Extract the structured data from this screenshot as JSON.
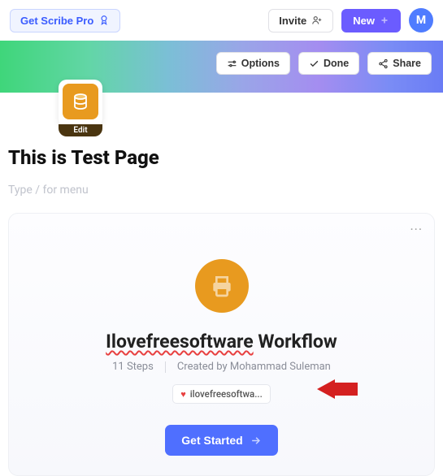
{
  "topbar": {
    "pro_label": "Get Scribe Pro",
    "invite_label": "Invite",
    "new_label": "New",
    "avatar_initial": "M"
  },
  "banner": {
    "options_label": "Options",
    "done_label": "Done",
    "share_label": "Share"
  },
  "doc_icon": {
    "edit_label": "Edit"
  },
  "page": {
    "title": "This is  Test Page",
    "menu_hint": "Type / for menu"
  },
  "card": {
    "title_spellcheck": "Ilovefreesoftware",
    "title_rest": " Workflow",
    "steps_label": "11 Steps",
    "author_label": "Created by Mohammad Suleman",
    "tag_label": "ilovefreesoftwa...",
    "start_label": "Get Started",
    "menu_label": "···"
  },
  "colors": {
    "accent_orange": "#e89a1f",
    "primary_blue": "#4F6FFF",
    "purple": "#6B5CFF"
  }
}
